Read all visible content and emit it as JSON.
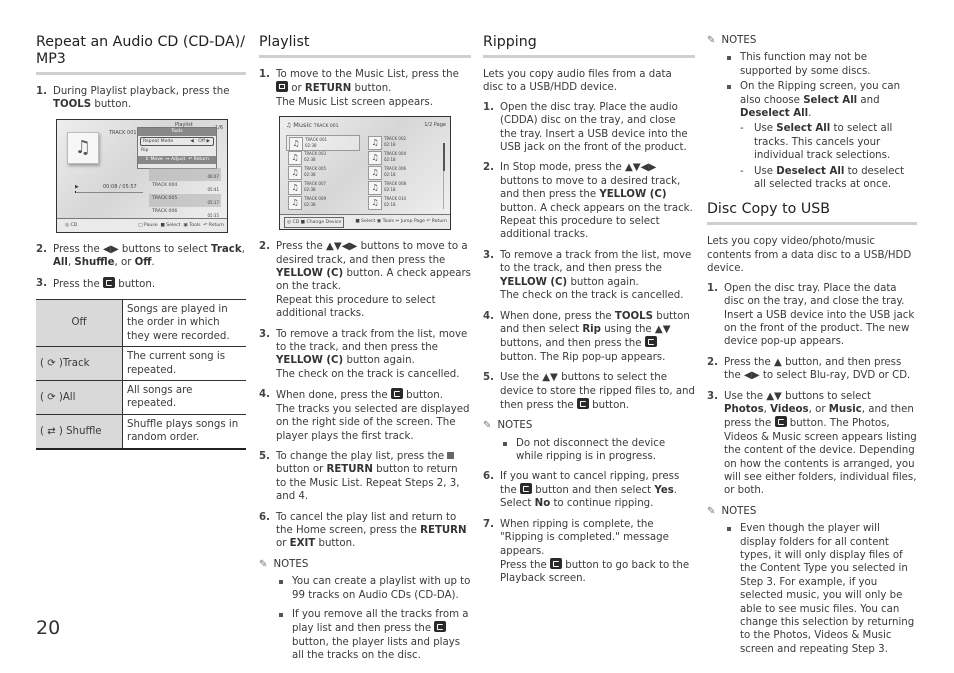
{
  "page_number": "20",
  "col1": {
    "title": "Repeat an Audio CD (CD-DA)/ MP3",
    "step1": {
      "num": "1.",
      "pre": "During Playlist playback, press the ",
      "b1": "TOOLS",
      "post": " button."
    },
    "screen": {
      "track_title": "TRACK 001",
      "playlist_label": "Playlist",
      "page_label": "1/6",
      "tools_title": "Tools",
      "repeat_mode_label": "Repeat Mode",
      "repeat_mode_value": "Off",
      "rip_label": "Rip",
      "hint_move": "Move",
      "hint_adjust": "Adjust",
      "hint_return": "Return",
      "tracks": [
        {
          "name": "",
          "time": "06:07"
        },
        {
          "name": "TRACK 004",
          "time": "05:41"
        },
        {
          "name": "TRACK 005",
          "time": "05:17"
        },
        {
          "name": "TRACK 006",
          "time": "05:35"
        }
      ],
      "progress_time": "00:08 / 05:57",
      "progress_fraction": 0.02,
      "source": "CD",
      "footer": [
        "Pause",
        "Select",
        "Tools",
        "Return"
      ]
    },
    "step2": {
      "num": "2.",
      "pre": "Press the ◀▶ buttons to select ",
      "b1": "Track",
      "s1": ", ",
      "b2": "All",
      "s2": ", ",
      "b3": "Shuffle",
      "s3": ", or ",
      "b4": "Off",
      "post": "."
    },
    "step3": {
      "num": "3.",
      "pre": "Press the ",
      "post": " button."
    },
    "table": [
      {
        "mode": "Off",
        "desc": "Songs are played in the order in which they were recorded."
      },
      {
        "mode": "Track",
        "desc": "The current song is repeated."
      },
      {
        "mode": "All",
        "desc": "All songs are repeated."
      },
      {
        "mode": "Shuffle",
        "desc": "Shuffle plays songs in random order."
      }
    ]
  },
  "col2": {
    "title": "Playlist",
    "step1": {
      "num": "1.",
      "pre": "To move to the Music List, press the ",
      "mid": " or ",
      "b1": "RETURN",
      "post": " button.",
      "line2": "The Music List screen appears."
    },
    "screen": {
      "header_title": "Music",
      "header_track": "TRACK 001",
      "page": "1/2 Page",
      "tracks": [
        {
          "name": "TRACK 001",
          "time": "02:38"
        },
        {
          "name": "TRACK 002",
          "time": "02:18"
        },
        {
          "name": "TRACK 003",
          "time": "02:38"
        },
        {
          "name": "TRACK 004",
          "time": "02:18"
        },
        {
          "name": "TRACK 005",
          "time": "02:38"
        },
        {
          "name": "TRACK 006",
          "time": "02:18"
        },
        {
          "name": "TRACK 007",
          "time": "02:38"
        },
        {
          "name": "TRACK 008",
          "time": "02:18"
        },
        {
          "name": "TRACK 009",
          "time": "02:38"
        },
        {
          "name": "TRACK 010",
          "time": "02:18"
        }
      ],
      "footer_left_source": "CD",
      "footer_left_action": "Change Device",
      "footer_right": [
        "Select",
        "Tools",
        "Jump Page",
        "Return"
      ]
    },
    "step2": {
      "num": "2.",
      "pre": "Press the ▲▼◀▶ buttons to move to a desired track, and then press the ",
      "b1": "YELLOW (C)",
      "post": " button. A check appears on the track.",
      "line2": "Repeat this procedure to select additional tracks."
    },
    "step3": {
      "num": "3.",
      "pre": "To remove a track from the list, move to the track, and then press the ",
      "b1": "YELLOW (C)",
      "post": " button again.",
      "line2": "The check on the track is cancelled."
    },
    "step4": {
      "num": "4.",
      "pre": "When done, press the ",
      "post": " button.",
      "line2": "The tracks you selected are displayed on the right side of the screen. The player plays the first track."
    },
    "step5": {
      "num": "5.",
      "pre": "To change the play list, press the ",
      "mid": " button or ",
      "b1": "RETURN",
      "post": " button to return to the Music List. Repeat Steps 2, 3, and 4."
    },
    "step6": {
      "num": "6.",
      "pre": "To cancel the play list and return to the Home screen, press the ",
      "b1": "RETURN",
      "mid": " or ",
      "b2": "EXIT",
      "post": " button."
    },
    "notes_label": "NOTES",
    "notes": [
      {
        "text": "You can create a playlist with up to 99 tracks on Audio CDs (CD-DA)."
      },
      {
        "pre": "If you remove all the tracks from a play list and then press the ",
        "post": " button, the player lists and plays all the tracks on the disc."
      }
    ]
  },
  "col3": {
    "title": "Ripping",
    "intro": "Lets you copy audio files from a data disc to a USB/HDD device.",
    "step1": {
      "num": "1.",
      "text": "Open the disc tray. Place the audio (CDDA) disc on the tray, and close the tray. Insert a USB device into the USB jack on the front of the product."
    },
    "step2": {
      "num": "2.",
      "pre": "In Stop mode, press the ▲▼◀▶ buttons to move to a desired track, and then press the ",
      "b1": "YELLOW (C)",
      "post": " button. A check appears on the track.",
      "line2": "Repeat this procedure to select additional tracks."
    },
    "step3": {
      "num": "3.",
      "pre": "To remove a track from the list, move to the track, and then press the ",
      "b1": "YELLOW (C)",
      "post": " button again.",
      "line2": "The check on the track is cancelled."
    },
    "step4": {
      "num": "4.",
      "pre": "When done, press the ",
      "b1": "TOOLS",
      "mid": " button and then select ",
      "b2": "Rip",
      "mid2": " using the ▲▼ buttons, and then press the ",
      "post": " button. The Rip pop-up appears."
    },
    "step5": {
      "num": "5.",
      "pre": "Use the ▲▼ buttons to select the device to store the ripped files to, and then press the ",
      "post": " button."
    },
    "notes_label": "NOTES",
    "notes": [
      "Do not disconnect the device while ripping is in progress."
    ],
    "step6": {
      "num": "6.",
      "pre": "If you want to cancel ripping, press the ",
      "mid": " button and then select ",
      "b1": "Yes",
      "mid2": ". Select ",
      "b2": "No",
      "post": " to continue ripping."
    },
    "step7": {
      "num": "7.",
      "text": "When ripping is complete, the \"Ripping is completed.\" message appears.",
      "pre": "Press the ",
      "post": " button to go back to the Playback screen."
    }
  },
  "col4": {
    "notes_label": "NOTES",
    "notes1": "This function may not be supported by some discs.",
    "notes2": {
      "pre": "On the Ripping screen, you can also choose ",
      "b1": "Select All",
      "mid": " and ",
      "b2": "Deselect All",
      "post": "."
    },
    "dash1": {
      "pre": "Use ",
      "b1": "Select All",
      "post": " to select all tracks. This cancels your individual track selections."
    },
    "dash2": {
      "pre": "Use ",
      "b1": "Deselect All",
      "post": " to deselect all selected tracks at once."
    },
    "title": "Disc Copy to USB",
    "intro": "Lets you copy video/photo/music contents from a data disc to a USB/HDD device.",
    "step1": {
      "num": "1.",
      "text": "Open the disc tray. Place the data disc on the tray, and close the tray. Insert a USB device into the USB jack on the front of the product. The new device pop-up appears."
    },
    "step2": {
      "num": "2.",
      "text": "Press the ▲ button, and then press the ◀▶ to select Blu-ray, DVD or CD."
    },
    "step3": {
      "num": "3.",
      "pre": "Use the ▲▼ buttons to select ",
      "b1": "Photos",
      "s1": ", ",
      "b2": "Videos",
      "s2": ", or ",
      "b3": "Music",
      "mid": ", and then press the ",
      "post": " button. The Photos, Videos & Music screen appears listing the content of the device. Depending on how the contents is arranged, you will see either folders, individual files, or both."
    },
    "notes": [
      "Even though the player will display folders for all content types, it will only display files of the Content Type you selected in Step 3. For example, if you selected music, you will only be able to see music files. You can change this selection by returning to the Photos, Videos & Music screen and repeating Step 3."
    ]
  }
}
